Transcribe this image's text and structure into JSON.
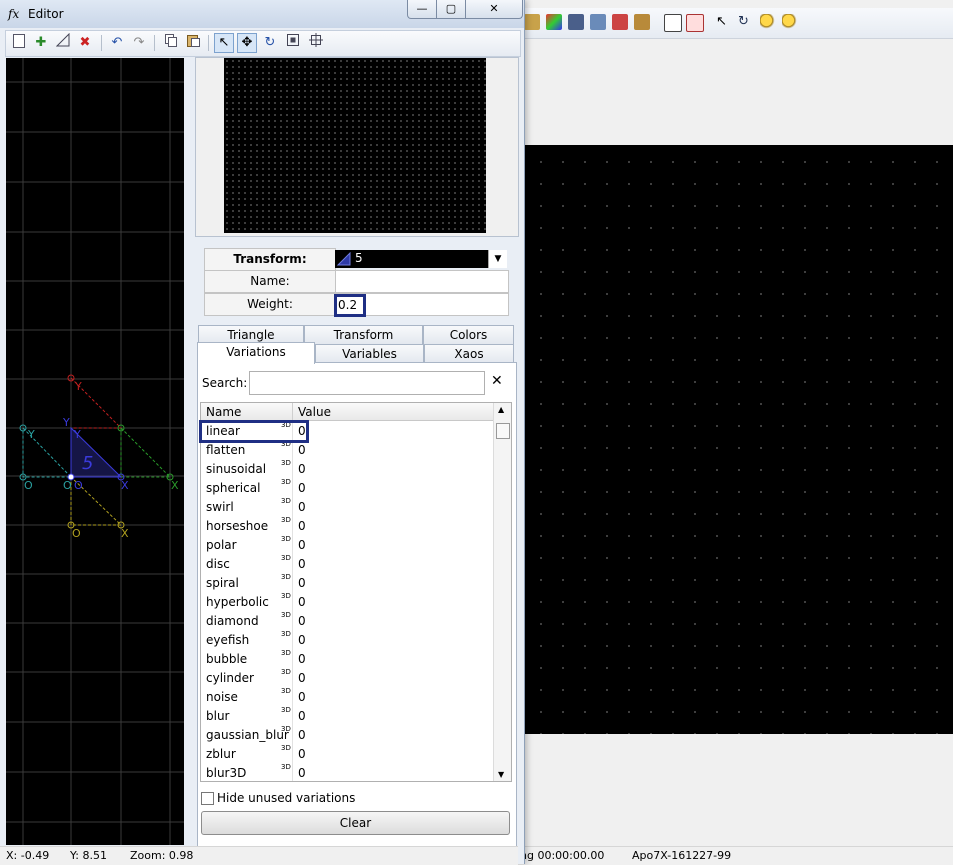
{
  "editor": {
    "title": "Editor",
    "title_icon": "fx",
    "minimize": "—",
    "maximize": "▢",
    "close": "✕"
  },
  "transform": {
    "transform_label": "Transform:",
    "transform_value": "5",
    "name_label": "Name:",
    "name_value": "",
    "weight_label": "Weight:",
    "weight_value": "0.2"
  },
  "tabs": {
    "triangle": "Triangle",
    "transform": "Transform",
    "colors": "Colors",
    "variations": "Variations",
    "variables": "Variables",
    "xaos": "Xaos"
  },
  "search": {
    "label": "Search:",
    "value": "",
    "clear": "✕"
  },
  "grid": {
    "col_name": "Name",
    "col_value": "Value",
    "rows": [
      {
        "name": "linear",
        "badge": "3D",
        "value": "0"
      },
      {
        "name": "flatten",
        "badge": "3D",
        "value": "0"
      },
      {
        "name": "sinusoidal",
        "badge": "3D",
        "value": "0"
      },
      {
        "name": "spherical",
        "badge": "3D",
        "value": "0"
      },
      {
        "name": "swirl",
        "badge": "3D",
        "value": "0"
      },
      {
        "name": "horseshoe",
        "badge": "3D",
        "value": "0"
      },
      {
        "name": "polar",
        "badge": "3D",
        "value": "0"
      },
      {
        "name": "disc",
        "badge": "3D",
        "value": "0"
      },
      {
        "name": "spiral",
        "badge": "3D",
        "value": "0"
      },
      {
        "name": "hyperbolic",
        "badge": "3D",
        "value": "0"
      },
      {
        "name": "diamond",
        "badge": "3D",
        "value": "0"
      },
      {
        "name": "eyefish",
        "badge": "3D",
        "value": "0"
      },
      {
        "name": "bubble",
        "badge": "3D",
        "value": "0"
      },
      {
        "name": "cylinder",
        "badge": "3D",
        "value": "0"
      },
      {
        "name": "noise",
        "badge": "3D",
        "value": "0"
      },
      {
        "name": "blur",
        "badge": "3D",
        "value": "0"
      },
      {
        "name": "gaussian_blur",
        "badge": "3D",
        "value": "0"
      },
      {
        "name": "zblur",
        "badge": "3D",
        "value": "0"
      },
      {
        "name": "blur3D",
        "badge": "3D",
        "value": "0"
      }
    ]
  },
  "options": {
    "hide_unused": "Hide unused variations",
    "clear_button": "Clear"
  },
  "triangle_canvas": {
    "label_number": "5",
    "labels": [
      "Y",
      "Y",
      "Y",
      "Y",
      "O",
      "O",
      "O",
      "X",
      "X",
      "O",
      "X"
    ]
  },
  "editor_status": {
    "x": "X: -0.49",
    "y": "Y: 8.51",
    "zoom": "Zoom: 0.98"
  },
  "main_status": {
    "render_time": "ng 00:00:00.00",
    "build": "Apo7X-161227-99"
  },
  "colors": {
    "highlight": "#1f2f84",
    "canvas_bg": "#000000"
  }
}
